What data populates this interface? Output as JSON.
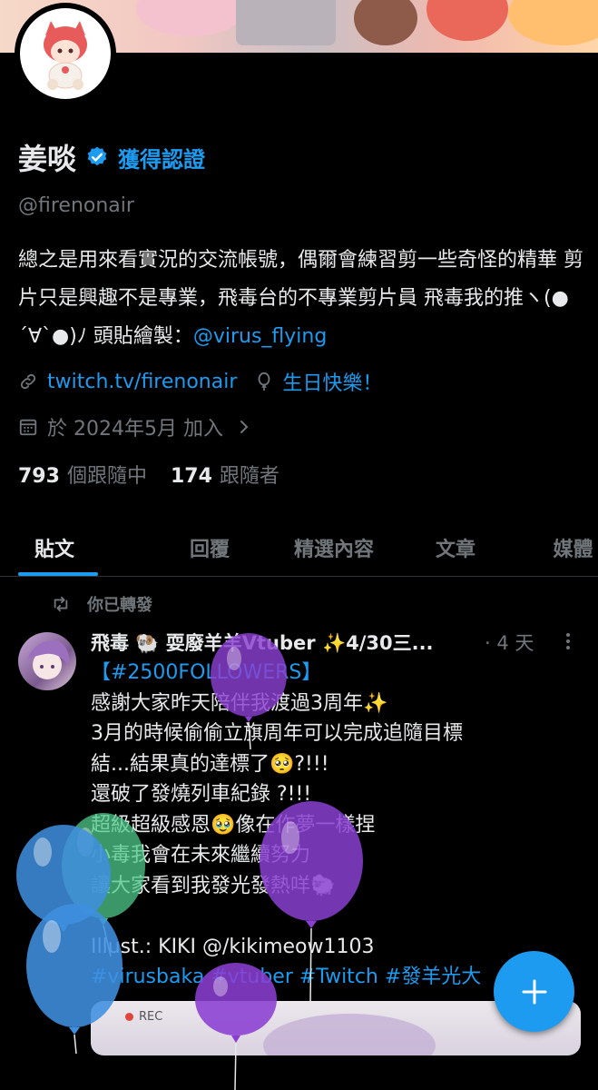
{
  "profile": {
    "name": "姜啖",
    "verified_label": "獲得認證",
    "handle": "@firenonair",
    "bio_text": "總之是用來看實況的交流帳號，偶爾會練習剪一些奇怪的精華 剪片只是興趣不是專業，飛毒台的不專業剪片員 飛毒我的推ヽ(●´∀`●)ﾉ 頭貼繪製：",
    "bio_mention": "@virus_flying",
    "link": "twitch.tv/firenonair",
    "birthday": "生日快樂！",
    "joined": "於 2024年5月 加入",
    "following_count": "793",
    "following_label": "個跟隨中",
    "followers_count": "174",
    "followers_label": "跟隨者"
  },
  "tabs": [
    "貼文",
    "回覆",
    "精選內容",
    "文章",
    "媒體"
  ],
  "repost_label": "你已轉發",
  "post": {
    "author": "飛毒 🐏 耍廢羊羊Vtuber ✨4/30三...",
    "time": "· 4 天",
    "line1": "【#2500FOLLOWERS】",
    "lines": "感謝大家昨天陪伴我渡過3周年✨\n3月的時候偷偷立旗周年可以完成追隨目標\n結...結果真的達標了🥺?!!!\n還破了發燒列車紀錄 ?!!!\n超級超級感恩🥹像在作夢一樣捏\n小毒我會在未來繼續努力\n讓大家看到我發光發熱咩🐑\n\nIllust.: KIKI @/kikimeow1103",
    "hashtags": "#virusbaka #vtuber #Twitch #發羊光大",
    "image_badge": "REC"
  },
  "colors": {
    "accent": "#1d9bf0",
    "text": "#e7e9ea",
    "muted": "#71767b",
    "balloon_purple": "#8a3fd1",
    "balloon_blue": "#3f8fe0",
    "balloon_green": "#4fc98a"
  },
  "icons": [
    "verified-badge-icon",
    "link-icon",
    "balloon-icon",
    "calendar-icon",
    "chevron-right-icon",
    "repost-icon",
    "more-icon",
    "plus-icon"
  ]
}
